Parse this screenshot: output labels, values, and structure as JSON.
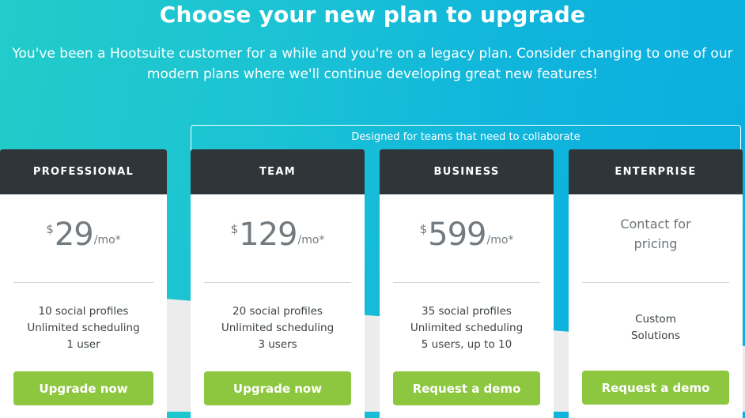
{
  "hero": {
    "title": "Choose your new plan to upgrade",
    "subtitle_line1": "You've been a Hootsuite customer for a while and you're on a legacy plan. Consider changing to one of our",
    "subtitle_line2": "modern plans where we'll continue developing great new features!"
  },
  "collab_banner": {
    "label": "Designed for teams that need to collaborate"
  },
  "plans": [
    {
      "name": "PROFESSIONAL",
      "currency": "$",
      "price": "29",
      "period": "/mo*",
      "features": [
        "10 social profiles",
        "Unlimited scheduling",
        "1 user"
      ],
      "cta": "Upgrade now"
    },
    {
      "name": "TEAM",
      "currency": "$",
      "price": "129",
      "period": "/mo*",
      "features": [
        "20 social profiles",
        "Unlimited scheduling",
        "3 users"
      ],
      "cta": "Upgrade now"
    },
    {
      "name": "BUSINESS",
      "currency": "$",
      "price": "599",
      "period": "/mo*",
      "features": [
        "35 social profiles",
        "Unlimited scheduling",
        "5 users, up to 10"
      ],
      "cta": "Request a demo"
    },
    {
      "name": "ENTERPRISE",
      "contact_line1": "Contact for",
      "contact_line2": "pricing",
      "features": [
        "Custom",
        "Solutions"
      ],
      "cta": "Request a demo"
    }
  ],
  "colors": {
    "header_dark": "#2f3538",
    "cta_green": "#8dc63f",
    "bg_gradient_start": "#22ccc9",
    "bg_gradient_end": "#0aaee0",
    "price_gray": "#737b80"
  }
}
